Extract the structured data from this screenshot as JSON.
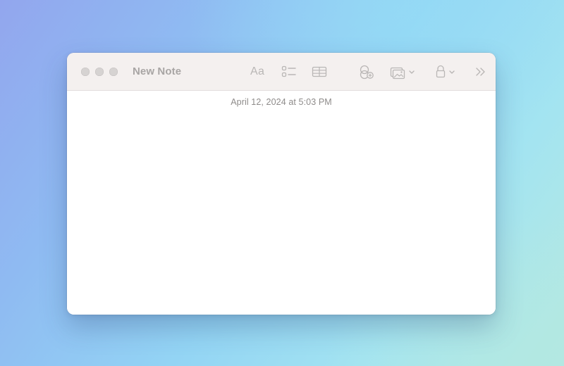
{
  "desktop": {
    "background_colors": [
      "#92a6ee",
      "#93d4f4",
      "#b6e9e0"
    ]
  },
  "window": {
    "title": "New Note",
    "traffic_lights": {
      "close": "close-button",
      "minimize": "minimize-button",
      "zoom": "zoom-button",
      "color": "#d6d3d2"
    },
    "toolbar": {
      "format_label": "Aa",
      "icons": [
        "text-format-icon",
        "checklist-icon",
        "table-icon",
        "collaborate-icon",
        "media-icon",
        "lock-icon",
        "more-chevrons-icon"
      ],
      "icon_color": "#b9b6b5",
      "background": "#f4f0ef"
    },
    "note": {
      "date": "April 12, 2024 at 5:03 PM",
      "body": ""
    }
  }
}
